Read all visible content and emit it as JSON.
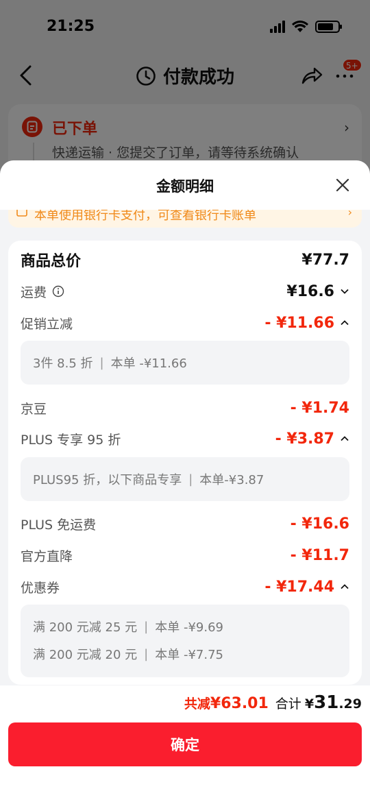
{
  "status_bar": {
    "time": "21:25"
  },
  "nav": {
    "title": "付款成功",
    "badge": "5+"
  },
  "order": {
    "status": "已下单",
    "description": "快递运输 · 您提交了订单，请等待系统确认"
  },
  "sheet": {
    "title": "金额明细",
    "bank_notice": "本单使用银行卡支付，可查看银行卡账单",
    "rows": {
      "goods_total": {
        "label": "商品总价",
        "value": "¥77.7"
      },
      "shipping": {
        "label": "运费",
        "value": "¥16.6"
      },
      "promo": {
        "label": "促销立减",
        "value": "- ¥11.66"
      },
      "promo_detail": {
        "text": "3件 8.5 折",
        "sep": "|",
        "amount": "本单 -¥11.66"
      },
      "jingdou": {
        "label": "京豆",
        "value": "- ¥1.74"
      },
      "plus_discount": {
        "label": "PLUS 专享 95 折",
        "value": "- ¥3.87"
      },
      "plus_detail": {
        "text": "PLUS95 折，以下商品专享",
        "sep": "|",
        "amount": "本单-¥3.87"
      },
      "plus_shipping": {
        "label": "PLUS 免运费",
        "value": "- ¥16.6"
      },
      "official_drop": {
        "label": "官方直降",
        "value": "- ¥11.7"
      },
      "coupon": {
        "label": "优惠券",
        "value": "- ¥17.44"
      },
      "coupon_details": [
        {
          "text": "满 200 元减 25 元",
          "sep": "|",
          "amount": "本单 -¥9.69"
        },
        {
          "text": "满 200 元减 20 元",
          "sep": "|",
          "amount": "本单 -¥7.75"
        }
      ]
    }
  },
  "footer": {
    "saved_label": "共减",
    "saved_amount": "¥63.01",
    "total_label": "合计",
    "total_currency": "¥",
    "total_int": "31",
    "total_dec": ".29",
    "confirm_label": "确定"
  },
  "colors": {
    "accent_red": "#f2270c",
    "button_red": "#fa1e2e",
    "notice_orange": "#f08a1a"
  }
}
